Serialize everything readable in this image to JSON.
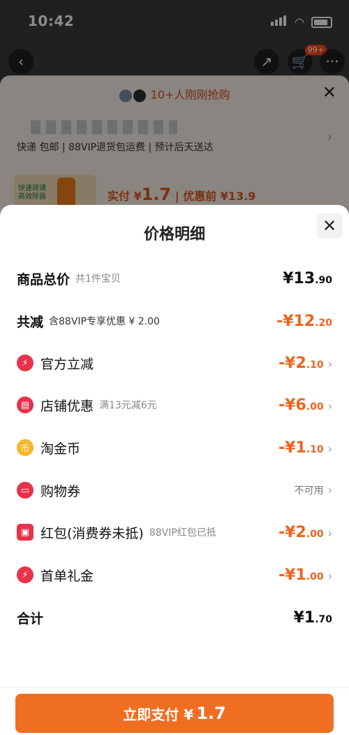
{
  "status_bar": {
    "time": "10:42"
  },
  "top_nav": {
    "cart_badge": "99+"
  },
  "order_sheet": {
    "buyers_text": "10+人刚刚抢购",
    "address_sub": "快递 包邮 | 88VIP退货包运费 | 预计后天送达",
    "thumb_text_1": "快速疏通",
    "thumb_text_2": "高效除菌",
    "pay_label": "实付 ¥",
    "pay_amount": "1.7",
    "pay_before": "| 优惠前 ¥13.9"
  },
  "price_detail": {
    "title": "价格明细",
    "rows": [
      {
        "label": "商品总价",
        "sub": "共1件宝贝",
        "val_main": "¥13",
        "val_dec": ".90",
        "color": "black"
      },
      {
        "label": "共减",
        "sub": "含88VIP专享优惠 ¥ 2.00",
        "val_main": "-¥12",
        "val_dec": ".20",
        "color": "orange"
      },
      {
        "label": "官方立减",
        "sub": "",
        "val_main": "-¥2",
        "val_dec": ".10",
        "color": "orange",
        "icon": "lightning-icon"
      },
      {
        "label": "店铺优惠",
        "sub": "满13元减6元",
        "val_main": "-¥6",
        "val_dec": ".00",
        "color": "orange",
        "icon": "shop-icon"
      },
      {
        "label": "淘金币",
        "sub": "",
        "val_main": "-¥1",
        "val_dec": ".10",
        "color": "orange",
        "icon": "coin-icon"
      },
      {
        "label": "购物券",
        "sub": "",
        "val_text": "不可用",
        "icon": "coupon-icon"
      },
      {
        "label": "红包(消费券未抵)",
        "sub": "88VIP红包已抵",
        "val_main": "-¥2",
        "val_dec": ".00",
        "color": "orange",
        "icon": "red-packet-icon"
      },
      {
        "label": "首单礼金",
        "sub": "",
        "val_main": "-¥1",
        "val_dec": ".00",
        "color": "orange",
        "icon": "lightning-icon"
      },
      {
        "label": "合计",
        "sub": "",
        "val_main": "¥1",
        "val_dec": ".70",
        "color": "black"
      }
    ]
  },
  "footer": {
    "button_label": "立即支付 ¥",
    "button_amount": "1.7"
  },
  "colors": {
    "accent": "#f06e22",
    "orange_text": "#f0641e",
    "icon_red": "#e8324a",
    "icon_gold": "#f5b62b"
  }
}
